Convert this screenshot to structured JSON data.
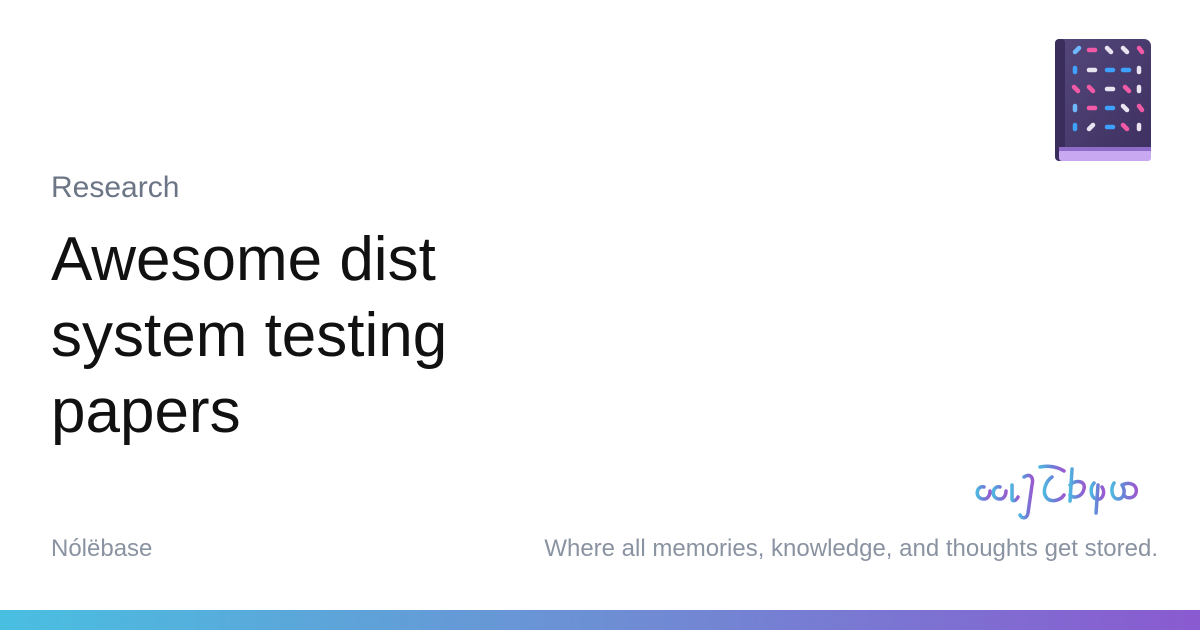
{
  "page": {
    "category": "Research",
    "title": "Awesome dist system testing papers",
    "site_name": "Nólëbase",
    "tagline": "Where all memories, knowledge, and thoughts get stored."
  },
  "icons": {
    "logo": "book-icon",
    "mark": "elvish-script-logo"
  },
  "colors": {
    "title": "#111111",
    "category": "#6b7585",
    "footer_text": "#8a93a1",
    "gradient_start": "#49bfe0",
    "gradient_end": "#8a5ad0",
    "book_cover": "#4a3b6e",
    "book_pages": "#b18ee8"
  }
}
